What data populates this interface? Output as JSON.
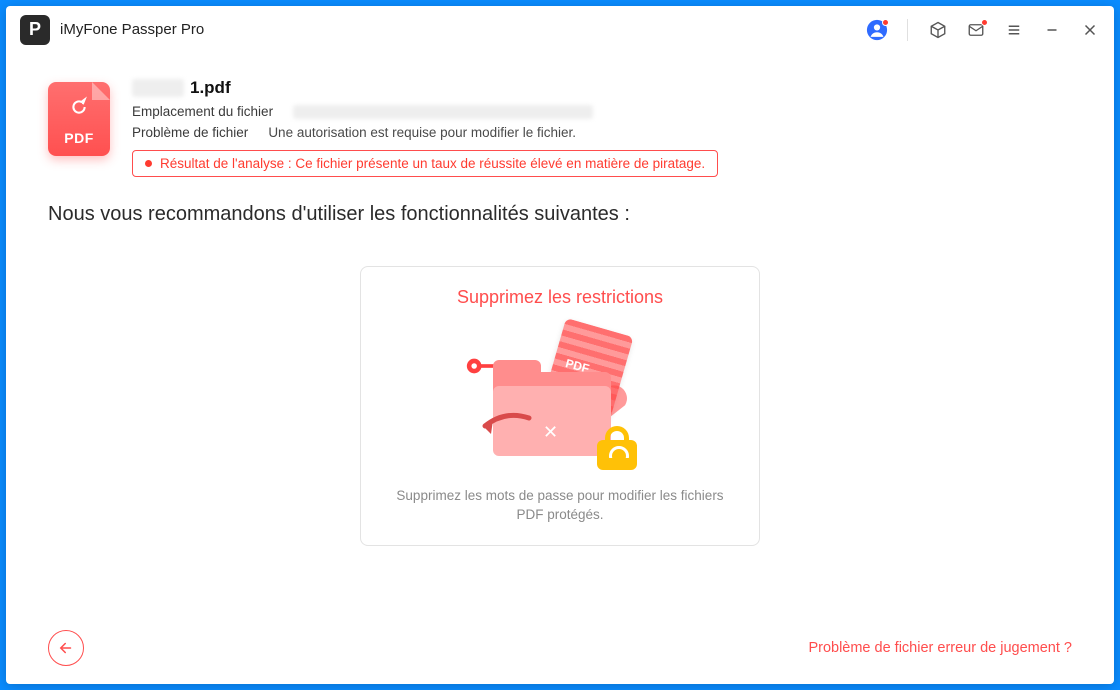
{
  "app": {
    "title": "iMyFone Passper Pro"
  },
  "titlebar": {
    "icons": {
      "user": "user-icon",
      "cube": "cube-icon",
      "mail": "mail-icon",
      "menu": "menu-icon",
      "minimize": "minimize-icon",
      "close": "close-icon"
    }
  },
  "file": {
    "icon_type": "PDF",
    "name_visible": "1.pdf",
    "location_label": "Emplacement du fichier",
    "location_value_hidden": true,
    "problem_label": "Problème de fichier",
    "problem_value": "Une autorisation est requise pour modifier le fichier.",
    "analysis_result": "Résultat de l'analyse : Ce fichier présente un taux de réussite élevé en matière de piratage."
  },
  "recommend_heading": "Nous vous recommandons d'utiliser les fonctionnalités suivantes :",
  "feature_card": {
    "title": "Supprimez les restrictions",
    "description": "Supprimez les mots de passe pour modifier les fichiers PDF protégés."
  },
  "footer": {
    "back_label": "back",
    "error_link": "Problème de fichier erreur de jugement ?"
  },
  "colors": {
    "accent_red": "#ff4d4d",
    "outer_blue": "#0a8cff",
    "user_blue": "#2F6BFF",
    "lock_yellow": "#ffc107"
  }
}
